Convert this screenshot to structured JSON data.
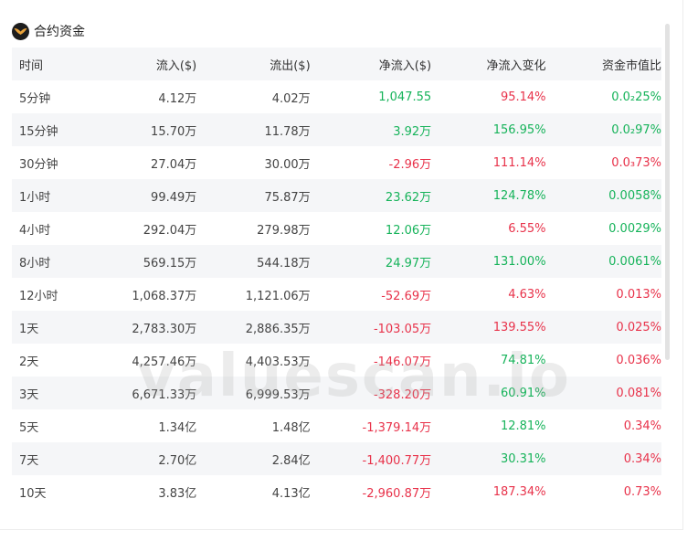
{
  "panel": {
    "title": "合约资金",
    "logo_icon": "wings-logo-icon"
  },
  "columns": [
    "时间",
    "流入($)",
    "流出($)",
    "净流入($)",
    "净流入变化",
    "资金市值比"
  ],
  "rows": [
    {
      "period": "5分钟",
      "inflow": "4.12万",
      "outflow": "4.02万",
      "net": "1,047.55",
      "net_sign": "pos",
      "change": "95.14%",
      "change_sign": "neg",
      "ratio": "0.0₂25%",
      "ratio_sign": "pos"
    },
    {
      "period": "15分钟",
      "inflow": "15.70万",
      "outflow": "11.78万",
      "net": "3.92万",
      "net_sign": "pos",
      "change": "156.95%",
      "change_sign": "pos",
      "ratio": "0.0₂97%",
      "ratio_sign": "pos"
    },
    {
      "period": "30分钟",
      "inflow": "27.04万",
      "outflow": "30.00万",
      "net": "-2.96万",
      "net_sign": "neg",
      "change": "111.14%",
      "change_sign": "neg",
      "ratio": "0.0₃73%",
      "ratio_sign": "neg"
    },
    {
      "period": "1小时",
      "inflow": "99.49万",
      "outflow": "75.87万",
      "net": "23.62万",
      "net_sign": "pos",
      "change": "124.78%",
      "change_sign": "pos",
      "ratio": "0.0058%",
      "ratio_sign": "pos"
    },
    {
      "period": "4小时",
      "inflow": "292.04万",
      "outflow": "279.98万",
      "net": "12.06万",
      "net_sign": "pos",
      "change": "6.55%",
      "change_sign": "neg",
      "ratio": "0.0029%",
      "ratio_sign": "pos"
    },
    {
      "period": "8小时",
      "inflow": "569.15万",
      "outflow": "544.18万",
      "net": "24.97万",
      "net_sign": "pos",
      "change": "131.00%",
      "change_sign": "pos",
      "ratio": "0.0061%",
      "ratio_sign": "pos"
    },
    {
      "period": "12小时",
      "inflow": "1,068.37万",
      "outflow": "1,121.06万",
      "net": "-52.69万",
      "net_sign": "neg",
      "change": "4.63%",
      "change_sign": "neg",
      "ratio": "0.013%",
      "ratio_sign": "neg"
    },
    {
      "period": "1天",
      "inflow": "2,783.30万",
      "outflow": "2,886.35万",
      "net": "-103.05万",
      "net_sign": "neg",
      "change": "139.55%",
      "change_sign": "neg",
      "ratio": "0.025%",
      "ratio_sign": "neg"
    },
    {
      "period": "2天",
      "inflow": "4,257.46万",
      "outflow": "4,403.53万",
      "net": "-146.07万",
      "net_sign": "neg",
      "change": "74.81%",
      "change_sign": "pos",
      "ratio": "0.036%",
      "ratio_sign": "neg"
    },
    {
      "period": "3天",
      "inflow": "6,671.33万",
      "outflow": "6,999.53万",
      "net": "-328.20万",
      "net_sign": "neg",
      "change": "60.91%",
      "change_sign": "pos",
      "ratio": "0.081%",
      "ratio_sign": "neg"
    },
    {
      "period": "5天",
      "inflow": "1.34亿",
      "outflow": "1.48亿",
      "net": "-1,379.14万",
      "net_sign": "neg",
      "change": "12.81%",
      "change_sign": "pos",
      "ratio": "0.34%",
      "ratio_sign": "neg"
    },
    {
      "period": "7天",
      "inflow": "2.70亿",
      "outflow": "2.84亿",
      "net": "-1,400.77万",
      "net_sign": "neg",
      "change": "30.31%",
      "change_sign": "pos",
      "ratio": "0.34%",
      "ratio_sign": "neg"
    },
    {
      "period": "10天",
      "inflow": "3.83亿",
      "outflow": "4.13亿",
      "net": "-2,960.87万",
      "net_sign": "neg",
      "change": "187.34%",
      "change_sign": "neg",
      "ratio": "0.73%",
      "ratio_sign": "neg"
    }
  ],
  "watermark": "valuescan.io",
  "colors": {
    "positive": "#16b35a",
    "negative": "#e8324a",
    "stripe": "#f5f6f8",
    "text": "#444444"
  }
}
